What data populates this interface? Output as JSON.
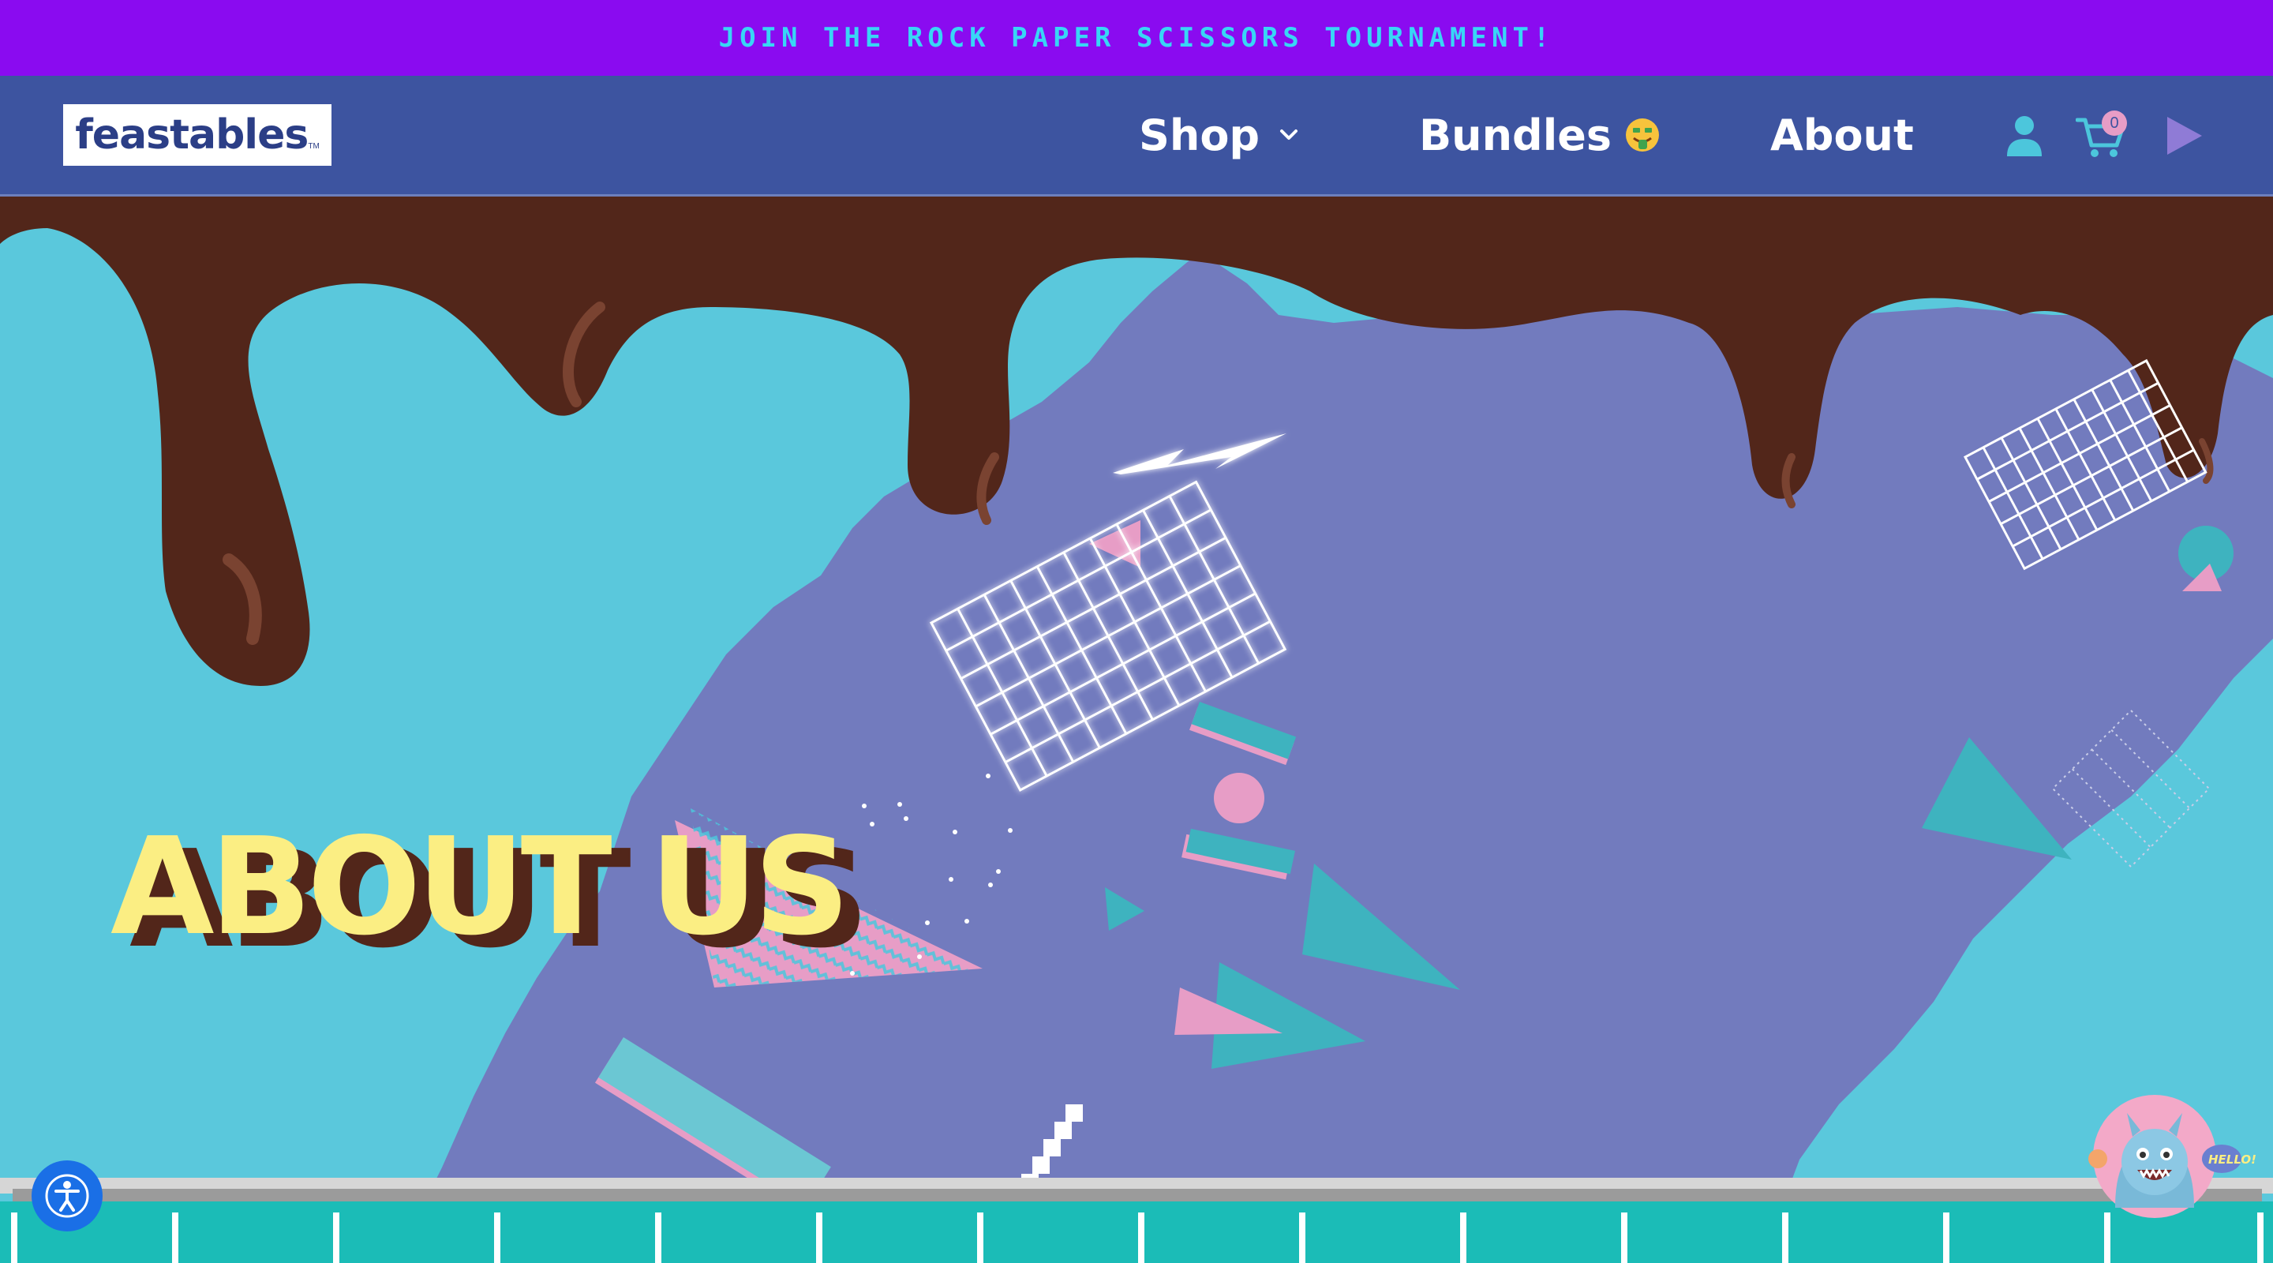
{
  "promo": {
    "text": "JOIN THE ROCK PAPER SCISSORS TOURNAMENT!"
  },
  "header": {
    "logo_text": "feastables",
    "logo_tm": "TM",
    "nav": [
      {
        "label": "Shop",
        "icon": "chevron-down-icon"
      },
      {
        "label": "Bundles",
        "icon": "money-mouth-face-emoji"
      },
      {
        "label": "About"
      }
    ],
    "account_icon": "user-icon",
    "cart": {
      "icon": "cart-icon",
      "count": "0"
    },
    "play_icon": "play-icon"
  },
  "hero": {
    "title": "ABOUT US"
  },
  "widgets": {
    "accessibility_icon": "accessibility-icon",
    "chat_bubble_text": "HELLO!"
  },
  "colors": {
    "promo_bg": "#8a0bf0",
    "promo_text": "#38d6f6",
    "header_bg": "#3d54a0",
    "sky": "#5ac8dc",
    "purple_splash": "#727bbe",
    "chocolate": "#52261a",
    "title_yellow": "#fbee83",
    "teal": "#3eb3bf",
    "pink": "#e79dc6"
  }
}
